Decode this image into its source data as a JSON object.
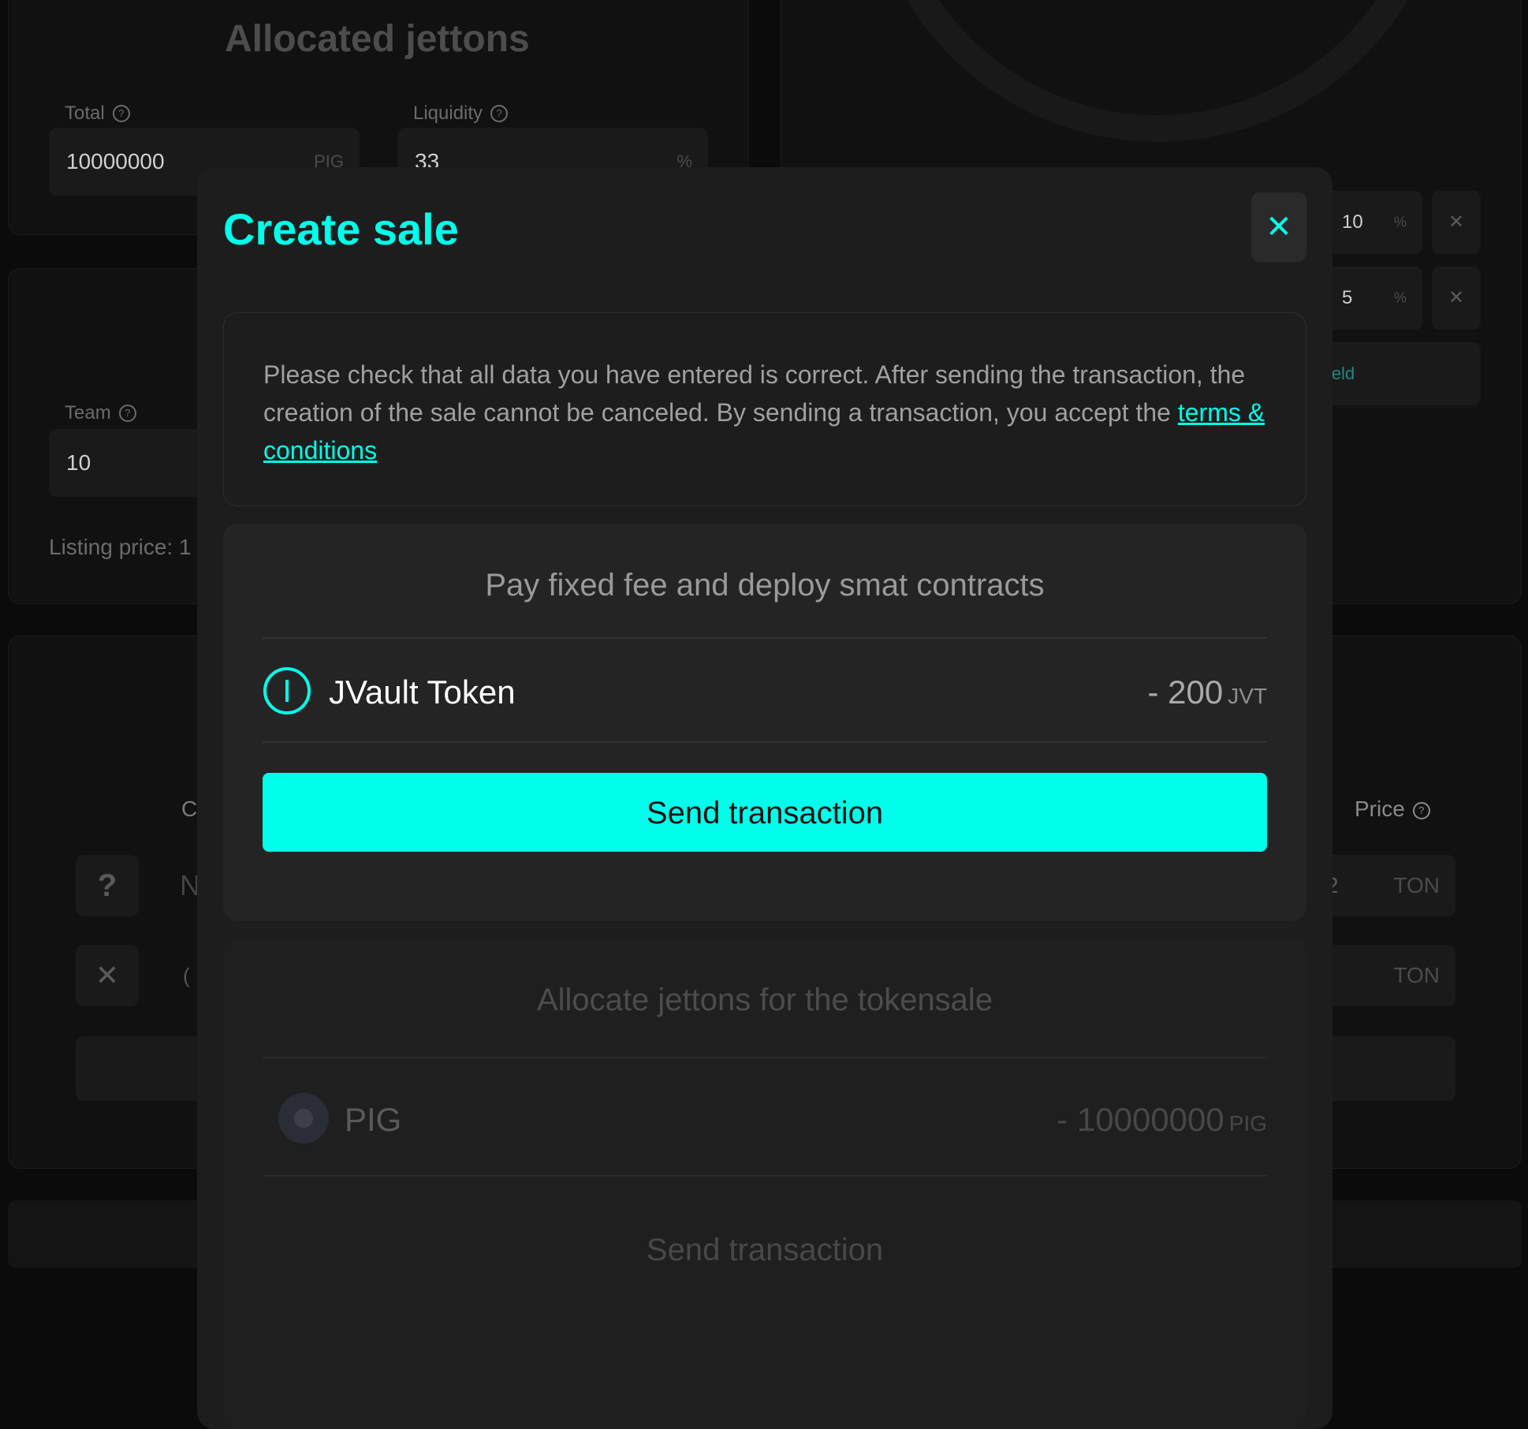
{
  "background": {
    "allocated_title": "Allocated jettons",
    "total_label": "Total",
    "total_value": "10000000",
    "total_unit": "PIG",
    "liquidity_label": "Liquidity",
    "liquidity_value": "33",
    "liquidity_unit": "%",
    "team_label": "Team",
    "team_value": "10",
    "listing_price_text": "Listing price: 1",
    "right_rows": [
      {
        "value": "10",
        "unit": "%"
      },
      {
        "value": "5",
        "unit": "%"
      }
    ],
    "add_field_fragment": "ield",
    "price_label": "Price",
    "ton_unit_1": "TON",
    "ton_unit_2": "TON",
    "ton_value_fragment": "2",
    "col_fragment": "C",
    "row_fragment_1": "N",
    "row_fragment_2": "(",
    "question_mark": "?",
    "remove_mark": "✕"
  },
  "modal": {
    "title": "Create sale",
    "close_icon": "✕",
    "notice_text": "Please check that all data you have entered is correct. After sending the transaction, the creation of the sale cannot be canceled. By sending a transaction, you accept the ",
    "notice_link": "terms & conditions",
    "step1": {
      "title": "Pay fixed fee and deploy smat contracts",
      "token_name": "JVault Token",
      "amount": "- 200",
      "unit": "JVT",
      "button": "Send transaction"
    },
    "step2": {
      "title": "Allocate jettons for the tokensale",
      "token_name": "PIG",
      "amount": "- 10000000",
      "unit": "PIG",
      "button": "Send transaction"
    }
  },
  "colors": {
    "accent": "#00ffea",
    "modal_bg": "#1d1d1d",
    "page_bg": "#0b0b0b"
  }
}
